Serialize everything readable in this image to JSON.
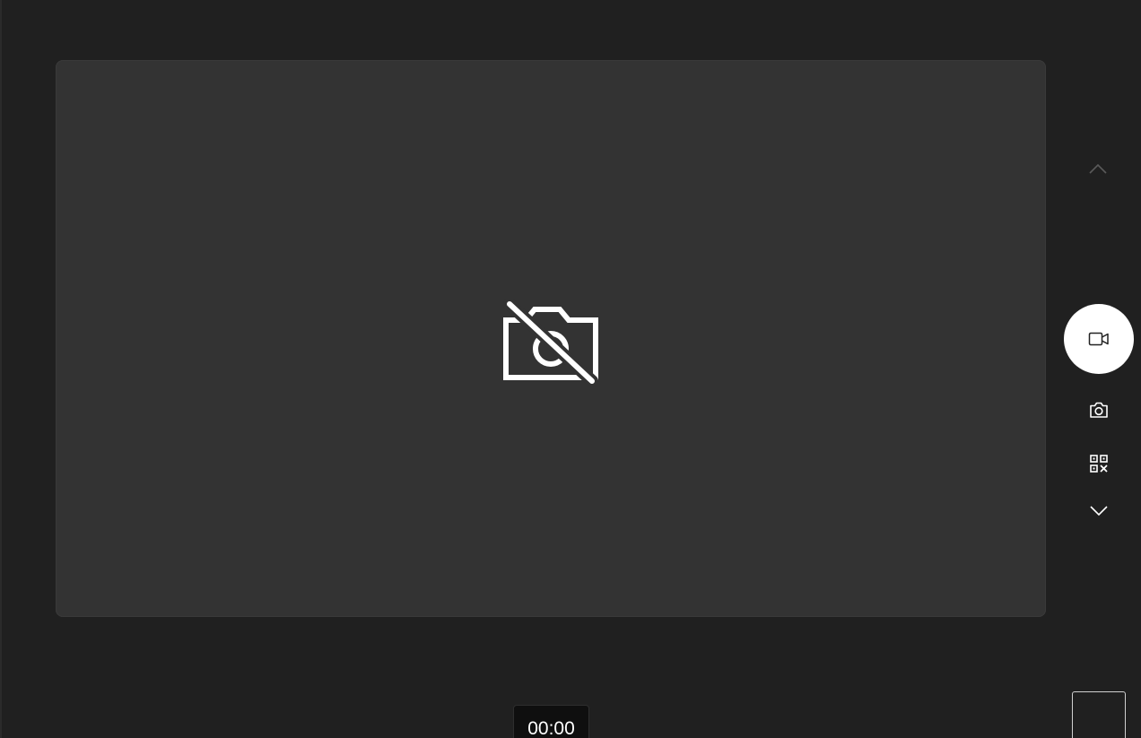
{
  "app": {
    "name": "Camera"
  },
  "preview": {
    "state_icon": "camera-off-icon"
  },
  "mode_switcher": {
    "up_icon": "chevron-up-icon",
    "down_icon": "chevron-down-icon",
    "modes": [
      {
        "id": "video",
        "icon": "video-icon",
        "selected": true
      },
      {
        "id": "photo",
        "icon": "camera-icon",
        "selected": false
      },
      {
        "id": "barcode",
        "icon": "qr-code-icon",
        "selected": false
      }
    ]
  },
  "recording": {
    "timer": "00:00"
  },
  "gallery": {
    "icon": "gallery-thumbnail"
  },
  "colors": {
    "background": "#202020",
    "preview": "#333333",
    "accent": "#ffffff"
  }
}
